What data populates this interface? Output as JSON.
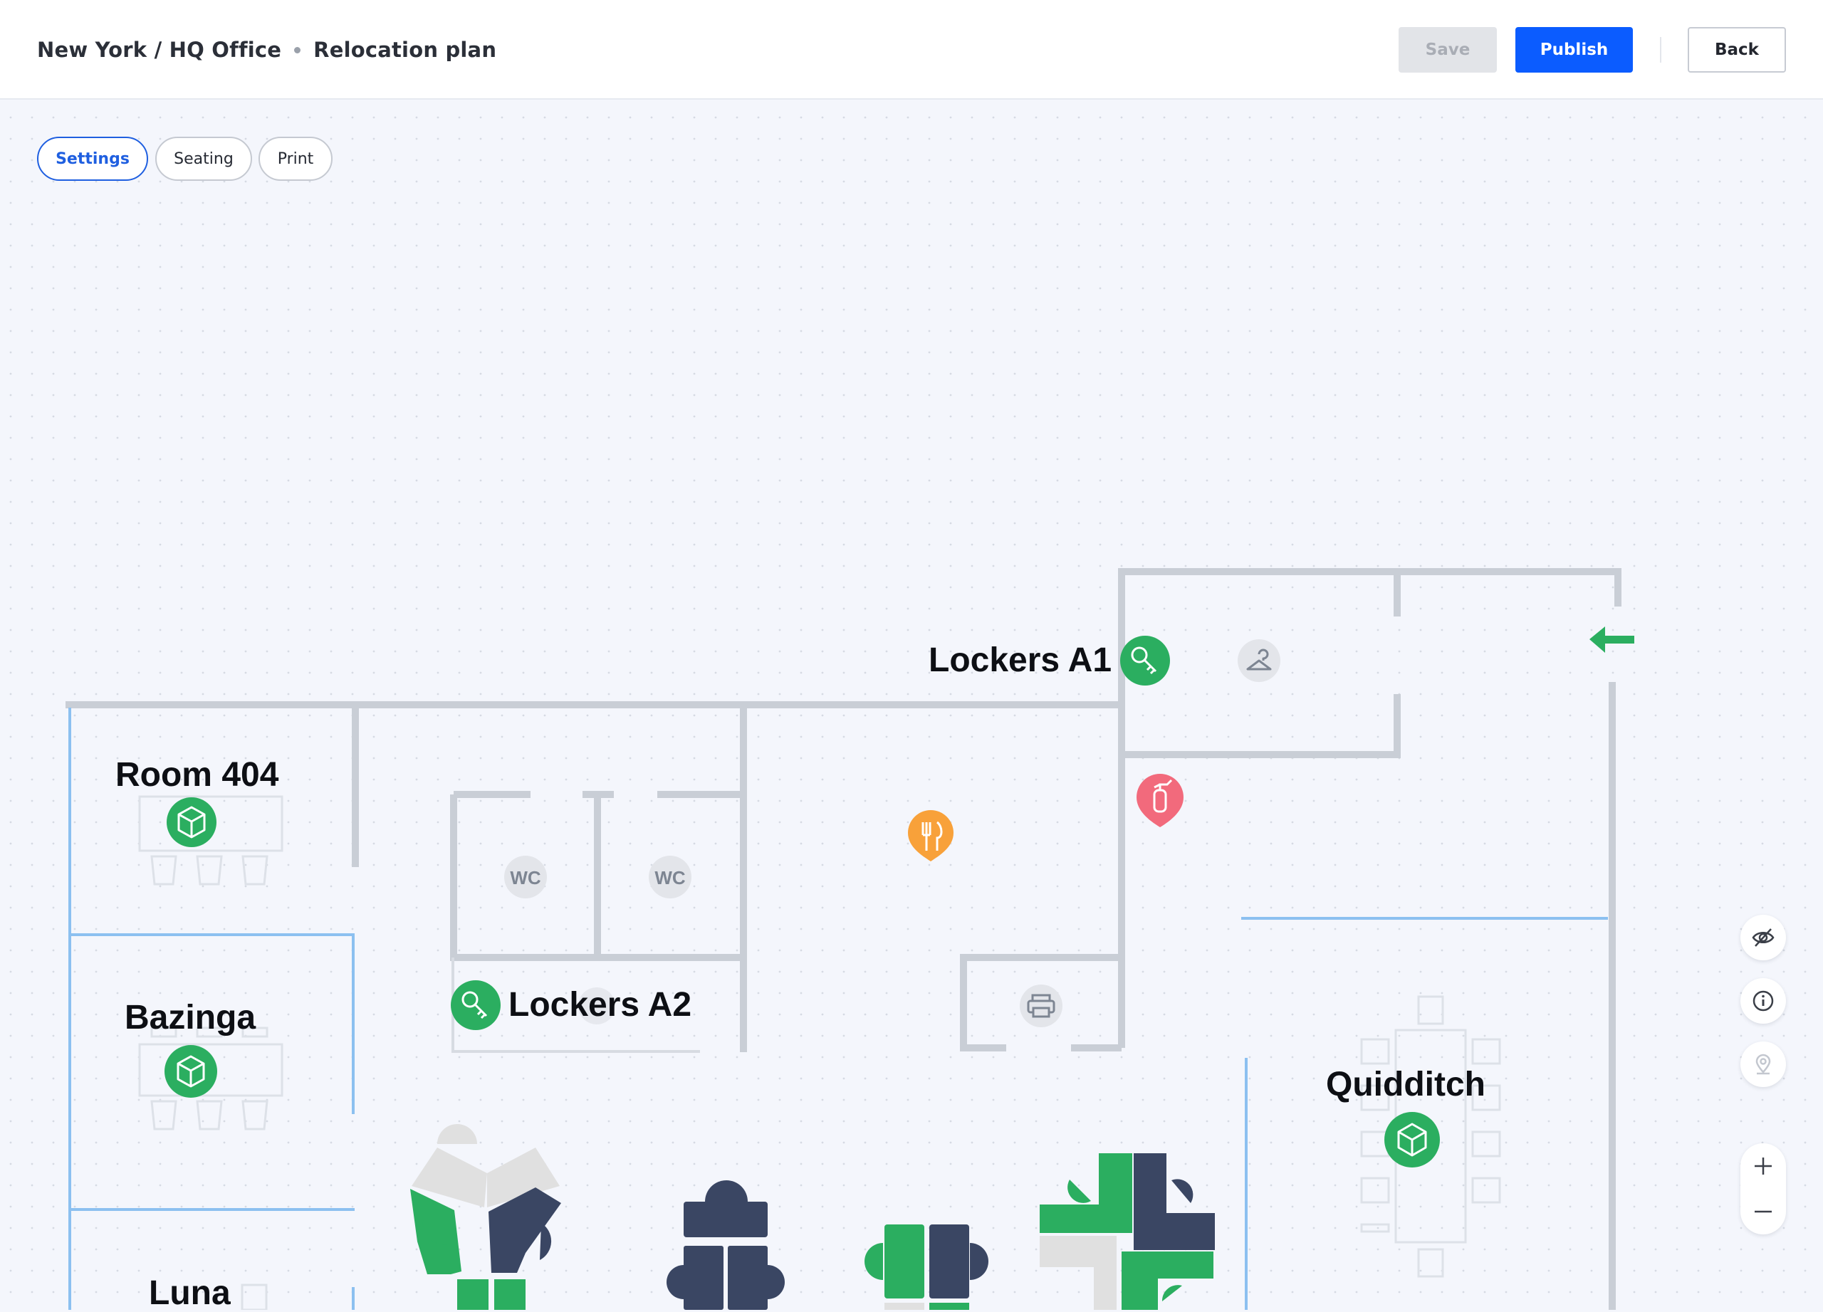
{
  "header": {
    "breadcrumb_location": "New York / HQ Office",
    "breadcrumb_plan": "Relocation plan",
    "save_label": "Save",
    "publish_label": "Publish",
    "back_label": "Back"
  },
  "tabs": [
    {
      "label": "Settings",
      "active": true
    },
    {
      "label": "Seating",
      "active": false
    },
    {
      "label": "Print",
      "active": false
    }
  ],
  "map": {
    "rooms": [
      {
        "label": "Lockers A1",
        "icon": "key-icon"
      },
      {
        "label": "Room 404",
        "icon": "cube-icon"
      },
      {
        "label": "Bazinga",
        "icon": "cube-icon"
      },
      {
        "label": "Lockers A2",
        "icon": "key-icon"
      },
      {
        "label": "Quidditch",
        "icon": "cube-icon"
      },
      {
        "label": "Luna",
        "icon": "cube-icon"
      }
    ],
    "amenities": [
      {
        "label": "WC",
        "icon": "wc-icon"
      },
      {
        "label": "WC",
        "icon": "wc-icon"
      },
      {
        "icon": "hanger-icon"
      },
      {
        "icon": "restaurant-icon"
      },
      {
        "icon": "fire-extinguisher-icon"
      },
      {
        "icon": "printer-icon"
      },
      {
        "icon": "exit-arrow-icon"
      }
    ]
  },
  "map_controls": [
    "hide-icon",
    "info-icon",
    "location-pin-icon",
    "zoom-in-icon",
    "zoom-out-icon"
  ],
  "colors": {
    "brand_blue": "#0b5cff",
    "wall_grey": "#c9ced6",
    "glass_blue": "#8cc0f0",
    "green": "#2bae60",
    "navy": "#3a4663",
    "orange": "#f8a13a",
    "red": "#f26a7c",
    "background": "#f4f6fc"
  }
}
